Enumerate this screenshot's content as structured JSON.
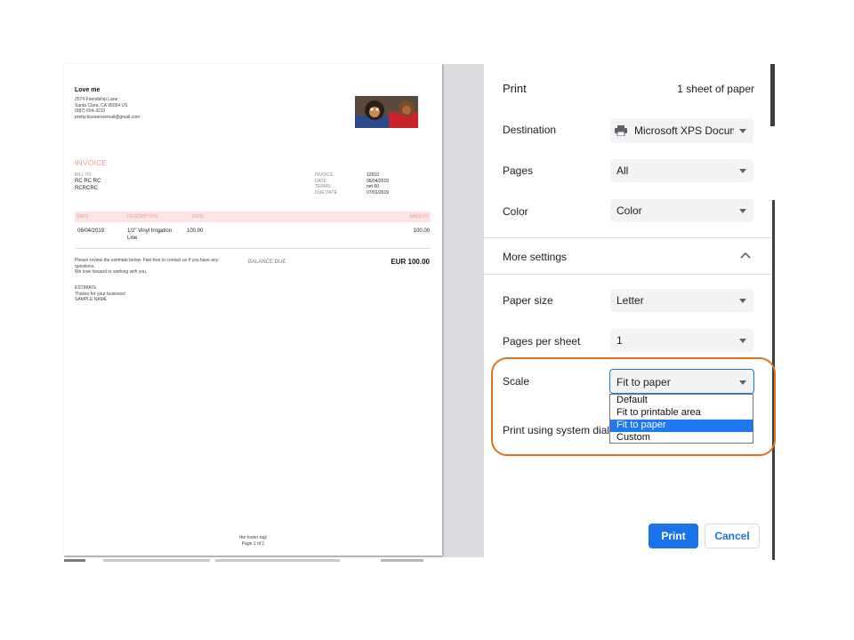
{
  "preview": {
    "company": "Love me",
    "address": [
      "2574 Friendship Lane",
      "Santa Clara, CA 95054 US",
      "(987) 654-3210",
      "pretty.businessemail@gmail.com"
    ],
    "invoice_title": "INVOICE",
    "bill_to_label": "BILL TO",
    "bill_to_lines": [
      "RC RC RC",
      "RCRCRC"
    ],
    "meta_labels": [
      "INVOICE",
      "DATE",
      "TERMS",
      "DUE DATE"
    ],
    "meta_values": [
      "12910",
      "06/04/2019",
      "net 60",
      "07/01/2019"
    ],
    "table_headers": {
      "date": "DATE",
      "description": "DESCRIPTION",
      "rate": "RATE",
      "amount": "AMOUNT"
    },
    "row": {
      "date": "06/04/2019",
      "description": "1/2\" Vinyl Irrigation Line",
      "rate": "100.00",
      "amount": "100.00"
    },
    "note_lines": [
      "Please review the estimate below.  Feel free to contact us if you have any",
      "questions.",
      "We look forward to working with you."
    ],
    "balance_label": "BALANCE DUE",
    "balance_value": "EUR 100.00",
    "sign_lines": [
      "ESTIMATE",
      "Thanks for your business!",
      "SAMPLE NAME"
    ],
    "footer_lines": [
      "the footer tagi",
      "Page 1 of 1"
    ]
  },
  "panel": {
    "title": "Print",
    "sheets": "1 sheet of paper",
    "destination_label": "Destination",
    "destination_value": "Microsoft XPS Docum",
    "pages_label": "Pages",
    "pages_value": "All",
    "color_label": "Color",
    "color_value": "Color",
    "more_settings_label": "More settings",
    "paper_size_label": "Paper size",
    "paper_size_value": "Letter",
    "pages_per_sheet_label": "Pages per sheet",
    "pages_per_sheet_value": "1",
    "scale_label": "Scale",
    "scale_value": "Fit to paper",
    "system_dialog_label": "Print using system dialog",
    "scale_options": [
      "Default",
      "Fit to printable area",
      "Fit to paper",
      "Custom"
    ],
    "selected_option_index": 2,
    "print_label": "Print",
    "cancel_label": "Cancel"
  },
  "colors": {
    "accent": "#1a73e8",
    "highlight_ring": "#d8731f",
    "invoice_pink": "#e8a09b"
  }
}
